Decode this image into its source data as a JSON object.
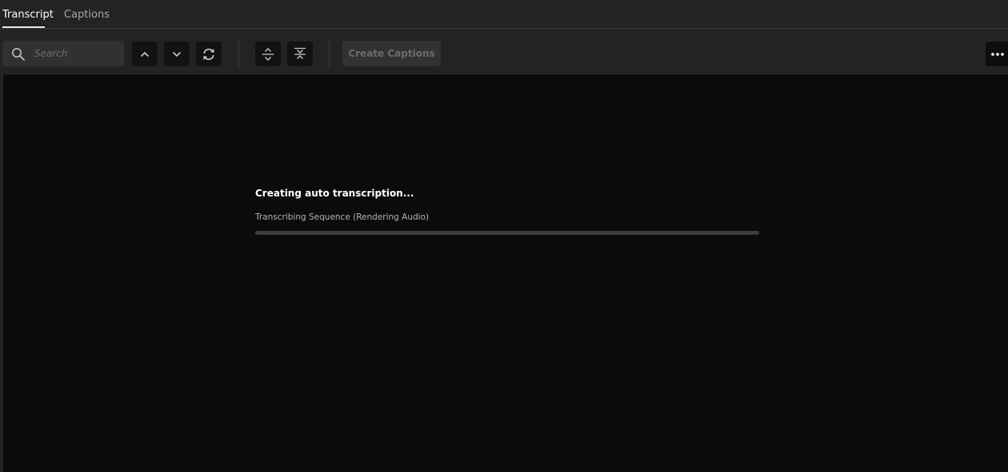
{
  "tabs": [
    {
      "label": "Transcript",
      "active": true
    },
    {
      "label": "Captions",
      "active": false
    }
  ],
  "toolbar": {
    "search": {
      "placeholder": "Search",
      "value": "",
      "icon": "search-icon"
    },
    "buttons": [
      {
        "icon": "chevron-up-icon"
      },
      {
        "icon": "chevron-down-icon"
      },
      {
        "icon": "refresh-icon"
      },
      {
        "icon": "expand-icon"
      },
      {
        "icon": "collapse-icon"
      }
    ],
    "create_captions_label": "Create Captions",
    "more_icon": "more-horizontal-icon"
  },
  "status": {
    "title": "Creating auto transcription...",
    "subtitle": "Transcribing Sequence (Rendering Audio)",
    "progress": 0
  },
  "colors": {
    "background": "#232323",
    "panel": "#0b0b0b",
    "button": "#121212",
    "progress_track": "#3d3d3d"
  }
}
